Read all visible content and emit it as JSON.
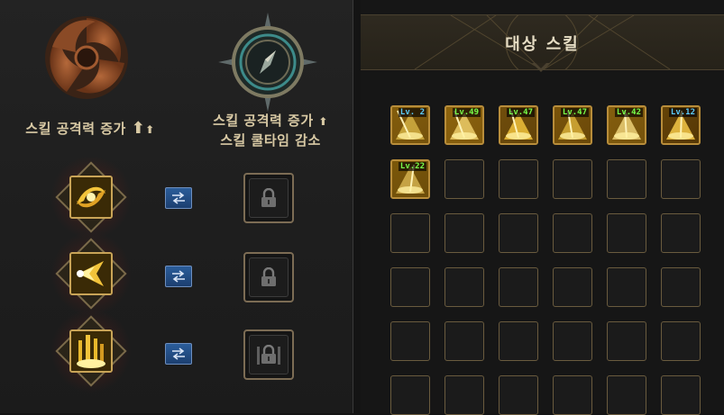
{
  "left": {
    "attack_title": "스킬 공격력 증가",
    "cooldown_title_line1": "스킬 공격력 증가",
    "cooldown_title_line2": "스킬 쿨타임 감소",
    "arrow_up": "⬆"
  },
  "right": {
    "title": "대상 스킬",
    "skills": [
      {
        "level": "Lv. 2",
        "badge_color": "#5ecbff"
      },
      {
        "level": "Lv.49",
        "badge_color": "#79ff4a"
      },
      {
        "level": "Lv.47",
        "badge_color": "#79ff4a"
      },
      {
        "level": "Lv.47",
        "badge_color": "#79ff4a"
      },
      {
        "level": "Lv.42",
        "badge_color": "#79ff4a"
      },
      {
        "level": "Lv.12",
        "badge_color": "#5ecbff"
      },
      {
        "level": "Lv.22",
        "badge_color": "#79ff4a"
      }
    ]
  },
  "colors": {
    "gold": "#c9a457",
    "swap_blue": "#2b5d9a"
  }
}
